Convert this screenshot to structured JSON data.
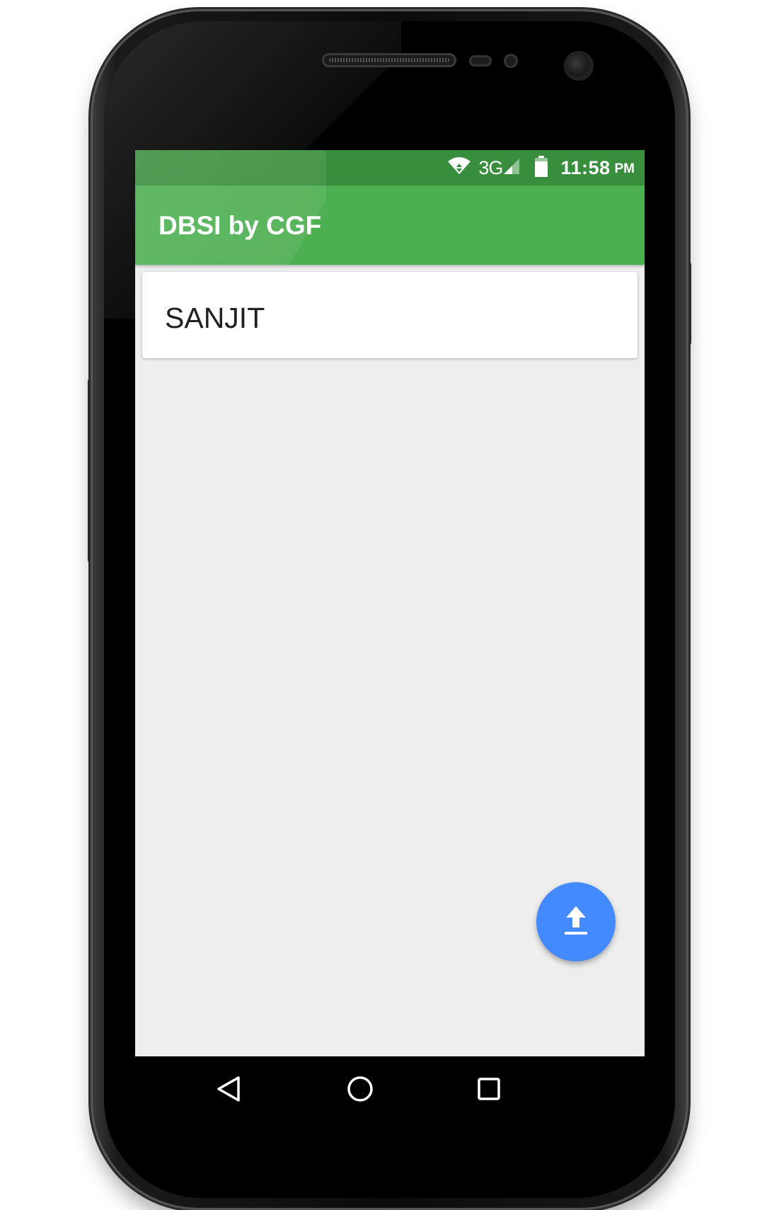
{
  "status_bar": {
    "network": "3G",
    "time": "11:58",
    "ampm": "PM",
    "icons": [
      "wifi-icon",
      "signal-icon",
      "battery-icon"
    ]
  },
  "app_bar": {
    "title": "DBSI by CGF",
    "color": "#4caf50",
    "status_color": "#388e3c"
  },
  "list": {
    "items": [
      {
        "label": "SANJIT"
      }
    ]
  },
  "fab": {
    "icon": "upload-icon",
    "color": "#448aff"
  },
  "nav_bar": {
    "buttons": [
      "back-icon",
      "home-icon",
      "recents-icon"
    ]
  }
}
